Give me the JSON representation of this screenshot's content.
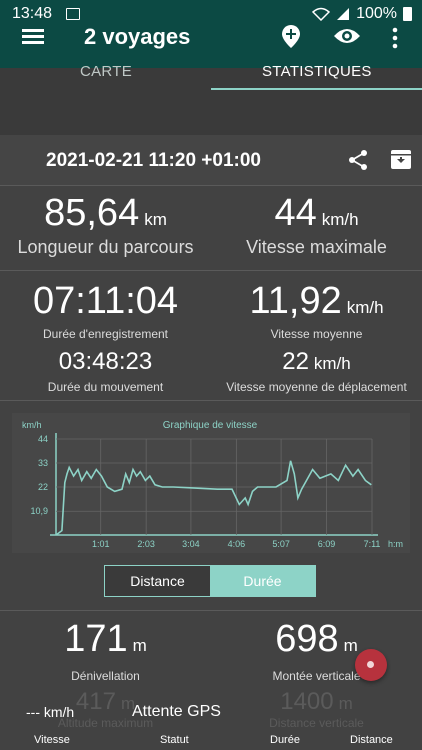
{
  "status": {
    "time": "13:48",
    "battery": "100%"
  },
  "appbar": {
    "title": "2 voyages"
  },
  "tabs": {
    "carte": "CARTE",
    "stats": "STATISTIQUES"
  },
  "header": {
    "datetime": "2021-02-21 11:20 +01:00"
  },
  "stats": {
    "length": {
      "value": "85,64",
      "unit": "km",
      "label": "Longueur du parcours"
    },
    "max_speed": {
      "value": "44",
      "unit": "km/h",
      "label": "Vitesse maximale"
    },
    "rec_duration": {
      "value": "07:11:04",
      "label": "Durée d'enregistrement"
    },
    "avg_speed": {
      "value": "11,92",
      "unit": "km/h",
      "label": "Vitesse moyenne"
    },
    "move_duration": {
      "value": "03:48:23",
      "label": "Durée du mouvement"
    },
    "avg_move_speed": {
      "value": "22",
      "unit": "km/h",
      "label": "Vitesse moyenne de déplacement"
    },
    "elevation": {
      "value": "171",
      "unit": "m",
      "label": "Dénivellation"
    },
    "climb": {
      "value": "698",
      "unit": "m",
      "label": "Montée verticale"
    },
    "alt_max": {
      "value": "417",
      "unit": "m",
      "label": "Altitude maximum"
    },
    "vertical_distance": {
      "value": "1400",
      "unit": "m",
      "label": "Distance verticale"
    }
  },
  "toggle": {
    "distance": "Distance",
    "duration": "Durée"
  },
  "bottom": {
    "speed_value": "--- km/h",
    "gps_status": "Attente GPS",
    "labels": [
      "Vitesse",
      "Statut",
      "Durée",
      "Distance"
    ]
  },
  "chart_data": {
    "type": "line",
    "title": "Graphique de vitesse",
    "ylabel": "km/h",
    "xlabel": "h:m",
    "yticks": [
      "10,9",
      "22",
      "33",
      "44"
    ],
    "xticks": [
      "1:01",
      "2:03",
      "3:04",
      "4:06",
      "5:07",
      "6:09",
      "7:11"
    ],
    "ylim": [
      0,
      44
    ],
    "xlim_minutes": [
      0,
      431
    ],
    "color": "#8dd3c7",
    "x": [
      0,
      8,
      12,
      15,
      18,
      24,
      30,
      35,
      42,
      48,
      55,
      62,
      70,
      80,
      90,
      95,
      100,
      105,
      110,
      115,
      122,
      128,
      135,
      145,
      160,
      190,
      220,
      240,
      250,
      258,
      262,
      268,
      275,
      300,
      315,
      320,
      325,
      330,
      335,
      340,
      350,
      360,
      375,
      385,
      395,
      405,
      412,
      422,
      430
    ],
    "y": [
      0,
      2,
      24,
      28,
      31,
      27,
      30,
      25,
      29,
      26,
      30,
      27,
      22,
      20,
      21,
      28,
      24,
      30,
      27,
      29,
      25,
      27,
      23,
      22,
      22,
      21.5,
      21,
      21,
      14,
      17,
      14,
      20,
      22,
      22,
      25,
      34,
      28,
      17,
      21,
      24,
      30,
      26,
      28,
      25,
      32,
      27,
      30,
      25,
      23
    ]
  },
  "colors": {
    "accent": "#8dd3c7",
    "bar": "#0c4a44",
    "fab": "#b7323d"
  }
}
